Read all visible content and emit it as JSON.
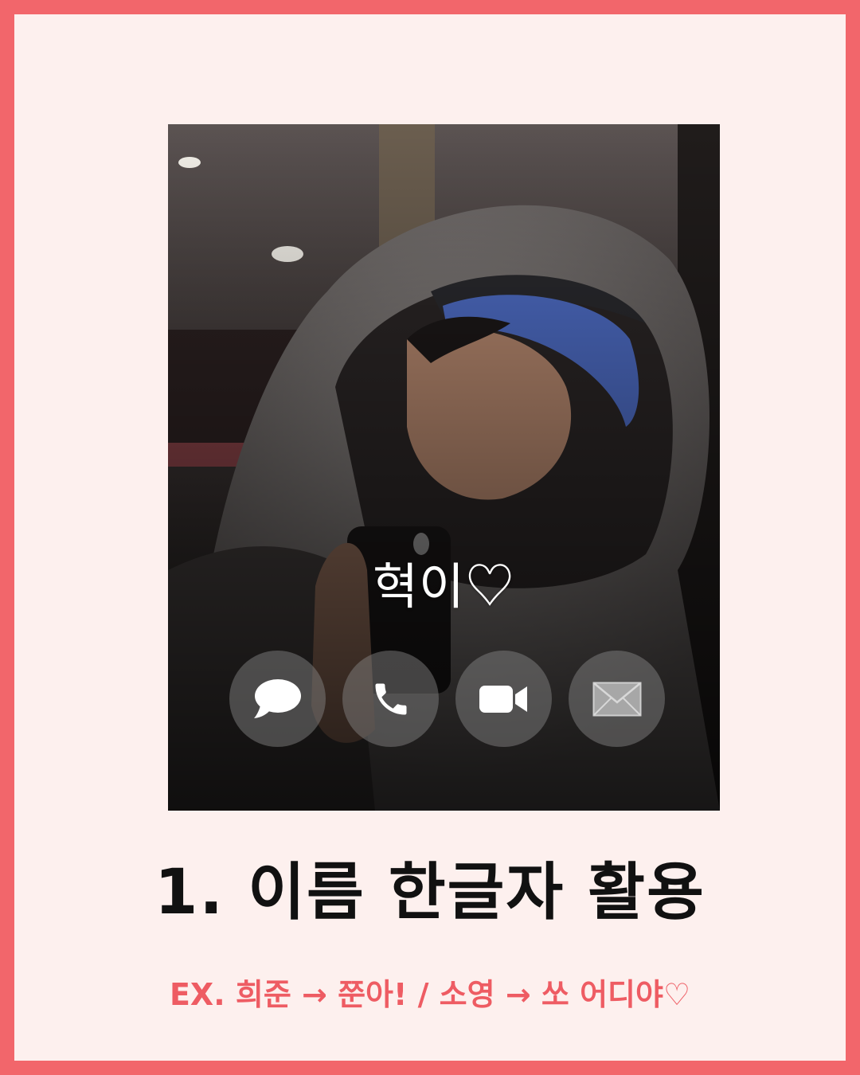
{
  "contact": {
    "name": "혁이♡",
    "actions": [
      {
        "id": "message",
        "icon": "speech-bubble-icon"
      },
      {
        "id": "call",
        "icon": "phone-icon"
      },
      {
        "id": "video",
        "icon": "video-camera-icon"
      },
      {
        "id": "mail",
        "icon": "envelope-icon"
      }
    ]
  },
  "caption": {
    "title": "1. 이름 한글자 활용",
    "example": "EX. 희준 → 쭌아! / 소영 → 쏘 어디야♡"
  },
  "colors": {
    "frame": "#f2666b",
    "card_bg": "#fdf0ee",
    "example_text": "#ee5c63",
    "title_text": "#111111"
  }
}
